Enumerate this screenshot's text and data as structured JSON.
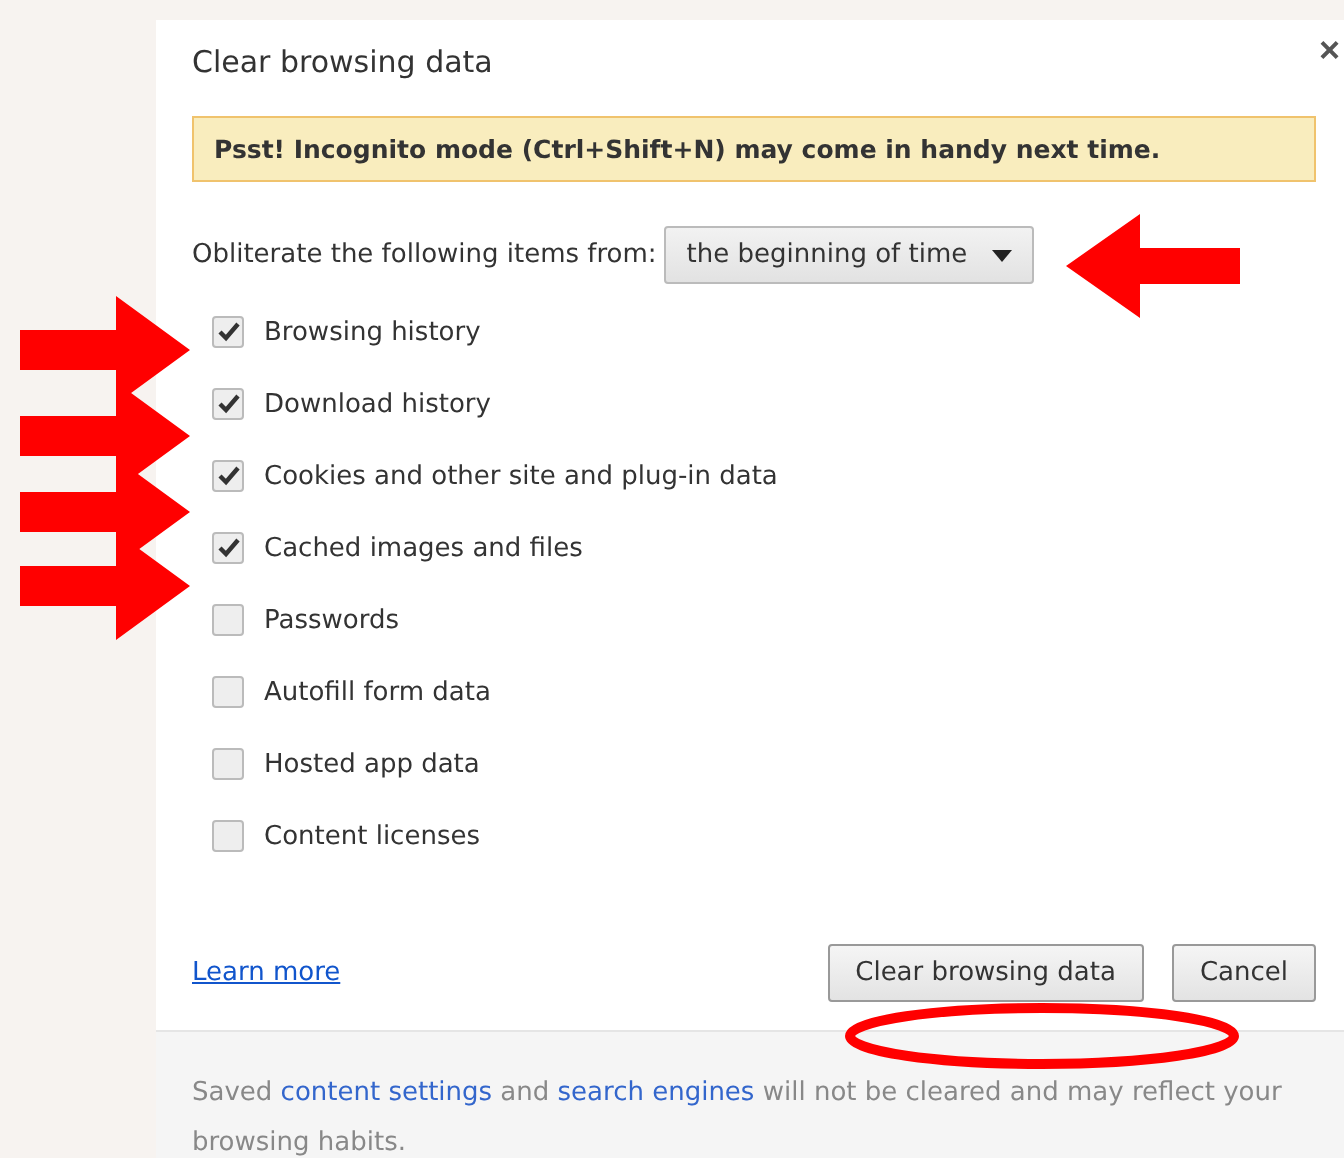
{
  "dialog": {
    "title": "Clear browsing data",
    "close": "×",
    "banner": "Psst! Incognito mode (Ctrl+Shift+N) may come in handy next time.",
    "range": {
      "label": "Obliterate the following items from:",
      "value": "the beginning of time"
    },
    "items": [
      {
        "label": "Browsing history",
        "checked": true
      },
      {
        "label": "Download history",
        "checked": true
      },
      {
        "label": "Cookies and other site and plug-in data",
        "checked": true
      },
      {
        "label": "Cached images and files",
        "checked": true
      },
      {
        "label": "Passwords",
        "checked": false
      },
      {
        "label": "Autofill form data",
        "checked": false
      },
      {
        "label": "Hosted app data",
        "checked": false
      },
      {
        "label": "Content licenses",
        "checked": false
      }
    ],
    "learn_more": "Learn more",
    "buttons": [
      "Clear browsing data",
      "Cancel"
    ],
    "footer": [
      {
        "kind": "text",
        "text": "Saved "
      },
      {
        "kind": "link",
        "text": "content settings"
      },
      {
        "kind": "text",
        "text": " and "
      },
      {
        "kind": "link",
        "text": "search engines"
      },
      {
        "kind": "text",
        "text": " will not be cleared and may reflect your browsing habits."
      }
    ]
  }
}
